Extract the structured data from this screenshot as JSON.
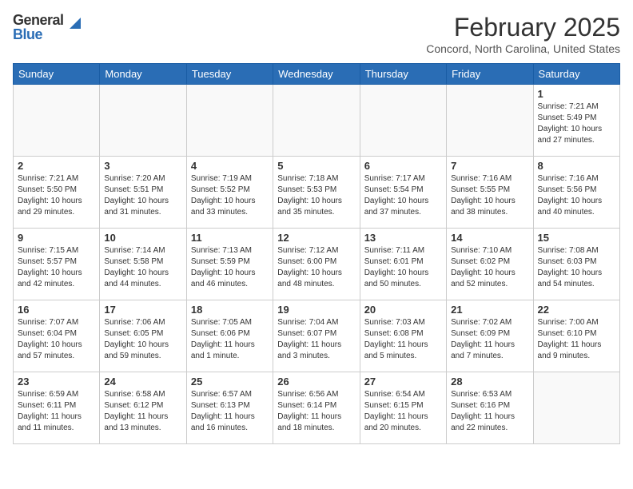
{
  "header": {
    "logo_general": "General",
    "logo_blue": "Blue",
    "month_title": "February 2025",
    "location": "Concord, North Carolina, United States"
  },
  "days_of_week": [
    "Sunday",
    "Monday",
    "Tuesday",
    "Wednesday",
    "Thursday",
    "Friday",
    "Saturday"
  ],
  "weeks": [
    [
      {
        "day": "",
        "info": ""
      },
      {
        "day": "",
        "info": ""
      },
      {
        "day": "",
        "info": ""
      },
      {
        "day": "",
        "info": ""
      },
      {
        "day": "",
        "info": ""
      },
      {
        "day": "",
        "info": ""
      },
      {
        "day": "1",
        "info": "Sunrise: 7:21 AM\nSunset: 5:49 PM\nDaylight: 10 hours and 27 minutes."
      }
    ],
    [
      {
        "day": "2",
        "info": "Sunrise: 7:21 AM\nSunset: 5:50 PM\nDaylight: 10 hours and 29 minutes."
      },
      {
        "day": "3",
        "info": "Sunrise: 7:20 AM\nSunset: 5:51 PM\nDaylight: 10 hours and 31 minutes."
      },
      {
        "day": "4",
        "info": "Sunrise: 7:19 AM\nSunset: 5:52 PM\nDaylight: 10 hours and 33 minutes."
      },
      {
        "day": "5",
        "info": "Sunrise: 7:18 AM\nSunset: 5:53 PM\nDaylight: 10 hours and 35 minutes."
      },
      {
        "day": "6",
        "info": "Sunrise: 7:17 AM\nSunset: 5:54 PM\nDaylight: 10 hours and 37 minutes."
      },
      {
        "day": "7",
        "info": "Sunrise: 7:16 AM\nSunset: 5:55 PM\nDaylight: 10 hours and 38 minutes."
      },
      {
        "day": "8",
        "info": "Sunrise: 7:16 AM\nSunset: 5:56 PM\nDaylight: 10 hours and 40 minutes."
      }
    ],
    [
      {
        "day": "9",
        "info": "Sunrise: 7:15 AM\nSunset: 5:57 PM\nDaylight: 10 hours and 42 minutes."
      },
      {
        "day": "10",
        "info": "Sunrise: 7:14 AM\nSunset: 5:58 PM\nDaylight: 10 hours and 44 minutes."
      },
      {
        "day": "11",
        "info": "Sunrise: 7:13 AM\nSunset: 5:59 PM\nDaylight: 10 hours and 46 minutes."
      },
      {
        "day": "12",
        "info": "Sunrise: 7:12 AM\nSunset: 6:00 PM\nDaylight: 10 hours and 48 minutes."
      },
      {
        "day": "13",
        "info": "Sunrise: 7:11 AM\nSunset: 6:01 PM\nDaylight: 10 hours and 50 minutes."
      },
      {
        "day": "14",
        "info": "Sunrise: 7:10 AM\nSunset: 6:02 PM\nDaylight: 10 hours and 52 minutes."
      },
      {
        "day": "15",
        "info": "Sunrise: 7:08 AM\nSunset: 6:03 PM\nDaylight: 10 hours and 54 minutes."
      }
    ],
    [
      {
        "day": "16",
        "info": "Sunrise: 7:07 AM\nSunset: 6:04 PM\nDaylight: 10 hours and 57 minutes."
      },
      {
        "day": "17",
        "info": "Sunrise: 7:06 AM\nSunset: 6:05 PM\nDaylight: 10 hours and 59 minutes."
      },
      {
        "day": "18",
        "info": "Sunrise: 7:05 AM\nSunset: 6:06 PM\nDaylight: 11 hours and 1 minute."
      },
      {
        "day": "19",
        "info": "Sunrise: 7:04 AM\nSunset: 6:07 PM\nDaylight: 11 hours and 3 minutes."
      },
      {
        "day": "20",
        "info": "Sunrise: 7:03 AM\nSunset: 6:08 PM\nDaylight: 11 hours and 5 minutes."
      },
      {
        "day": "21",
        "info": "Sunrise: 7:02 AM\nSunset: 6:09 PM\nDaylight: 11 hours and 7 minutes."
      },
      {
        "day": "22",
        "info": "Sunrise: 7:00 AM\nSunset: 6:10 PM\nDaylight: 11 hours and 9 minutes."
      }
    ],
    [
      {
        "day": "23",
        "info": "Sunrise: 6:59 AM\nSunset: 6:11 PM\nDaylight: 11 hours and 11 minutes."
      },
      {
        "day": "24",
        "info": "Sunrise: 6:58 AM\nSunset: 6:12 PM\nDaylight: 11 hours and 13 minutes."
      },
      {
        "day": "25",
        "info": "Sunrise: 6:57 AM\nSunset: 6:13 PM\nDaylight: 11 hours and 16 minutes."
      },
      {
        "day": "26",
        "info": "Sunrise: 6:56 AM\nSunset: 6:14 PM\nDaylight: 11 hours and 18 minutes."
      },
      {
        "day": "27",
        "info": "Sunrise: 6:54 AM\nSunset: 6:15 PM\nDaylight: 11 hours and 20 minutes."
      },
      {
        "day": "28",
        "info": "Sunrise: 6:53 AM\nSunset: 6:16 PM\nDaylight: 11 hours and 22 minutes."
      },
      {
        "day": "",
        "info": ""
      }
    ]
  ]
}
